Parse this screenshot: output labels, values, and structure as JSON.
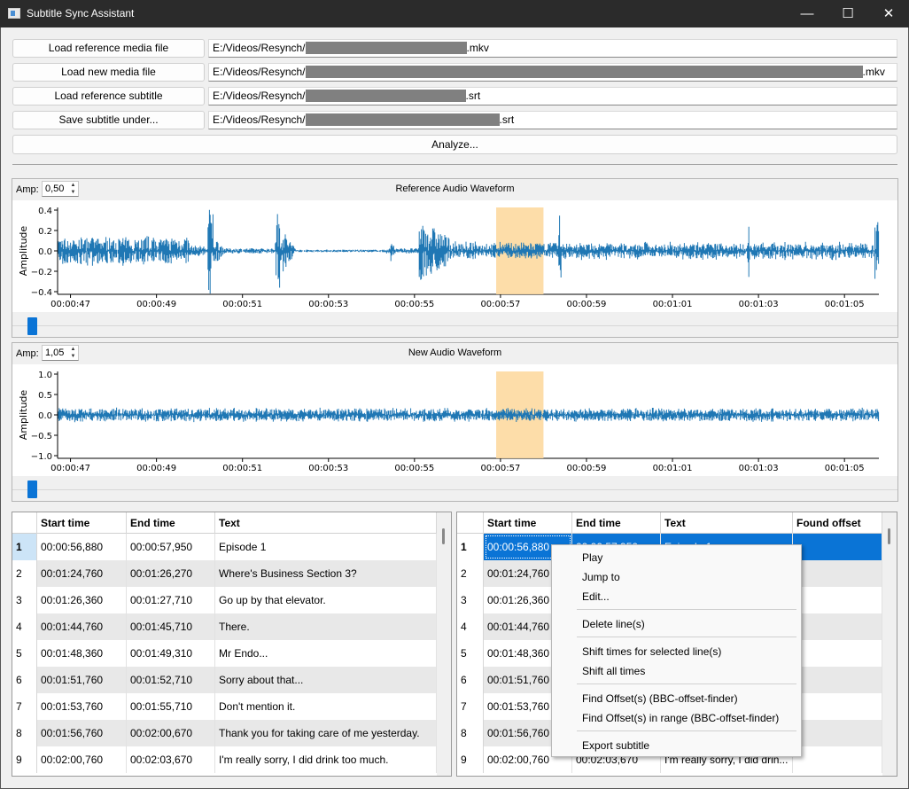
{
  "window": {
    "title": "Subtitle Sync Assistant",
    "minimize": "—",
    "maximize": "☐",
    "close": "✕"
  },
  "files": {
    "load_ref_media_label": "Load reference media file",
    "load_new_media_label": "Load new media file",
    "load_ref_sub_label": "Load reference subtitle",
    "save_sub_label": "Save subtitle under...",
    "ref_media_prefix": "E:/Videos/Resynch/",
    "ref_media_suffix": ".mkv",
    "new_media_prefix": "E:/Videos/Resynch/",
    "new_media_suffix": ".mkv",
    "ref_sub_prefix": "E:/Videos/Resynch/",
    "ref_sub_suffix": ".srt",
    "save_sub_prefix": "E:/Videos/Resynch/",
    "save_sub_suffix": ".srt"
  },
  "analyze_label": "Analyze...",
  "reference_wave": {
    "amp_label": "Amp:",
    "amp_value": "0,50",
    "title": "Reference Audio Waveform",
    "ylabel": "Amplitude",
    "yticks": [
      "0.4",
      "0.2",
      "0.0",
      "−0.2",
      "−0.4"
    ],
    "xticks": [
      "00:00:47",
      "00:00:49",
      "00:00:51",
      "00:00:53",
      "00:00:55",
      "00:00:57",
      "00:00:59",
      "00:01:01",
      "00:01:03",
      "00:01:05"
    ],
    "highlight_color": "#fdd9a0",
    "wave_color": "#1f77b4"
  },
  "new_wave": {
    "amp_label": "Amp:",
    "amp_value": "1,05",
    "title": "New Audio Waveform",
    "ylabel": "Amplitude",
    "yticks": [
      "1.0",
      "0.5",
      "0.0",
      "−0.5",
      "−1.0"
    ],
    "xticks": [
      "00:00:47",
      "00:00:49",
      "00:00:51",
      "00:00:53",
      "00:00:55",
      "00:00:57",
      "00:00:59",
      "00:01:01",
      "00:01:03",
      "00:01:05"
    ]
  },
  "left_table": {
    "headers": [
      "Start time",
      "End time",
      "Text"
    ],
    "rows": [
      [
        "1",
        "00:00:56,880",
        "00:00:57,950",
        "Episode 1"
      ],
      [
        "2",
        "00:01:24,760",
        "00:01:26,270",
        "Where's Business Section 3?"
      ],
      [
        "3",
        "00:01:26,360",
        "00:01:27,710",
        "Go up by that elevator."
      ],
      [
        "4",
        "00:01:44,760",
        "00:01:45,710",
        "There."
      ],
      [
        "5",
        "00:01:48,360",
        "00:01:49,310",
        "Mr Endo..."
      ],
      [
        "6",
        "00:01:51,760",
        "00:01:52,710",
        "Sorry about that..."
      ],
      [
        "7",
        "00:01:53,760",
        "00:01:55,710",
        "Don't mention it."
      ],
      [
        "8",
        "00:01:56,760",
        "00:02:00,670",
        "Thank you for taking care of me yesterday."
      ],
      [
        "9",
        "00:02:00,760",
        "00:02:03,670",
        "I'm really sorry, I did drink too much."
      ]
    ]
  },
  "right_table": {
    "headers": [
      "Start time",
      "End time",
      "Text",
      "Found offset"
    ],
    "rows": [
      [
        "1",
        "00:00:56,880",
        "00:00:57,950",
        "Episode 1",
        ""
      ],
      [
        "2",
        "00:01:24,760",
        "",
        "",
        ""
      ],
      [
        "3",
        "00:01:26,360",
        "",
        "",
        ""
      ],
      [
        "4",
        "00:01:44,760",
        "",
        "",
        ""
      ],
      [
        "5",
        "00:01:48,360",
        "",
        "",
        ""
      ],
      [
        "6",
        "00:01:51,760",
        "",
        "",
        ""
      ],
      [
        "7",
        "00:01:53,760",
        "",
        "",
        ""
      ],
      [
        "8",
        "00:01:56,760",
        "",
        "",
        ""
      ],
      [
        "9",
        "00:02:00,760",
        "00:02:03,670",
        "I'm really sorry, I did drin...",
        ""
      ]
    ]
  },
  "context_menu": {
    "play": "Play",
    "jump_to": "Jump to",
    "edit": "Edit...",
    "delete": "Delete line(s)",
    "shift_selected": "Shift times for selected line(s)",
    "shift_all": "Shift all times",
    "find_offsets": "Find Offset(s) (BBC-offset-finder)",
    "find_offsets_range": "Find Offset(s) in range (BBC-offset-finder)",
    "export": "Export subtitle"
  }
}
